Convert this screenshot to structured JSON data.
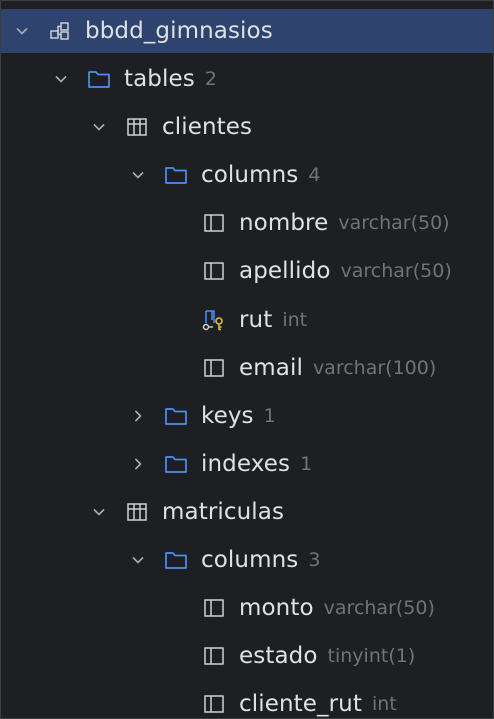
{
  "database": {
    "name": "bbdd_gimnasios",
    "tables_folder": {
      "label": "tables",
      "count": "2"
    },
    "tables": [
      {
        "name": "clientes",
        "columns_folder": {
          "label": "columns",
          "count": "4"
        },
        "columns": [
          {
            "name": "nombre",
            "type": "varchar(50)",
            "icon": "column-icon"
          },
          {
            "name": "apellido",
            "type": "varchar(50)",
            "icon": "column-icon"
          },
          {
            "name": "rut",
            "type": "int",
            "icon": "primary-key-column-icon"
          },
          {
            "name": "email",
            "type": "varchar(100)",
            "icon": "column-icon"
          }
        ],
        "keys_folder": {
          "label": "keys",
          "count": "1"
        },
        "indexes_folder": {
          "label": "indexes",
          "count": "1"
        }
      },
      {
        "name": "matriculas",
        "columns_folder": {
          "label": "columns",
          "count": "3"
        },
        "columns": [
          {
            "name": "monto",
            "type": "varchar(50)",
            "icon": "column-icon"
          },
          {
            "name": "estado",
            "type": "tinyint(1)",
            "icon": "column-icon"
          },
          {
            "name": "cliente_rut",
            "type": "int",
            "icon": "column-icon"
          }
        ]
      }
    ]
  },
  "colors": {
    "background": "#1e1f22",
    "selection": "#2e436e",
    "text": "#dfe1e5",
    "muted": "#6f737a",
    "folder_icon": "#4e8ff5",
    "key_icon": "#e8b93a"
  }
}
